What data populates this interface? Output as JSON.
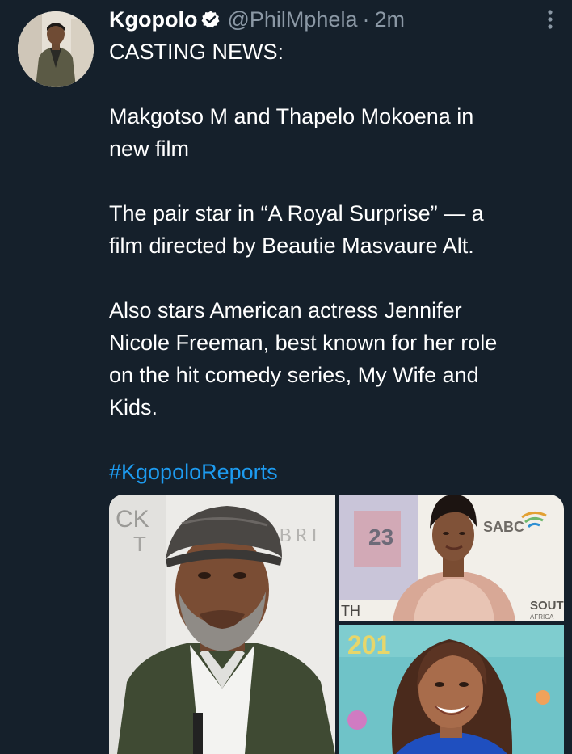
{
  "tweet": {
    "author": {
      "display_name": "Kgopolo",
      "handle": "@PhilMphela",
      "verified": true,
      "avatar_icon": "profile-photo"
    },
    "separator": "·",
    "time": "2m",
    "lines": [
      "CASTING NEWS:",
      "",
      "Makgotso M and Thapelo Mokoena in\nnew film",
      "",
      "The pair star in “A Royal Surprise” — a\nfilm directed by Beautie Masvaure Alt.",
      "",
      "Also stars American actress Jennifer\nNicole Freeman, best known for her role\non the hit comedy series, My Wife and\nKids.",
      ""
    ],
    "hashtag": "#KgopoloReports",
    "media": [
      {
        "name": "photo-thapelo-mokoena",
        "backdrop_texts": [
          "CK",
          "T",
          "BRI"
        ]
      },
      {
        "name": "photo-makgotso-m",
        "backdrop_texts": [
          "23",
          "SABC",
          "TH",
          "SOUTH",
          "AFRICA"
        ]
      },
      {
        "name": "photo-jennifer-freeman",
        "backdrop_texts": [
          "201"
        ]
      }
    ]
  },
  "colors": {
    "background": "#15202b",
    "text": "#ffffff",
    "secondary_text": "#8b98a5",
    "link": "#1d9bf0"
  }
}
